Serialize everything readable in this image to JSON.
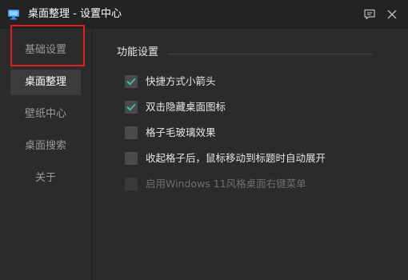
{
  "window": {
    "title": "桌面整理 - 设置中心",
    "app_icon": "monitor-icon",
    "buttons": {
      "feedback_icon": "message-icon",
      "close_icon": "close-icon"
    }
  },
  "sidebar": {
    "items": [
      {
        "label": "基础设置",
        "highlighted": true
      },
      {
        "label": "桌面整理",
        "active": true
      },
      {
        "label": "壁纸中心"
      },
      {
        "label": "桌面搜索"
      },
      {
        "label": "关于"
      }
    ]
  },
  "main": {
    "section_title": "功能设置",
    "options": [
      {
        "label": "快捷方式小箭头",
        "checked": true
      },
      {
        "label": "双击隐藏桌面图标",
        "checked": true
      },
      {
        "label": "格子毛玻璃效果",
        "checked": false
      },
      {
        "label": "收起格子后，鼠标移动到标题时自动展开",
        "checked": false
      },
      {
        "label": "启用Windows 11风格桌面右键菜单",
        "checked": false,
        "disabled": true
      }
    ]
  },
  "colors": {
    "background": "#2b2b2b",
    "titlebar": "#232323",
    "accent_check": "#3fc1b0",
    "highlight_border": "#e02020"
  }
}
